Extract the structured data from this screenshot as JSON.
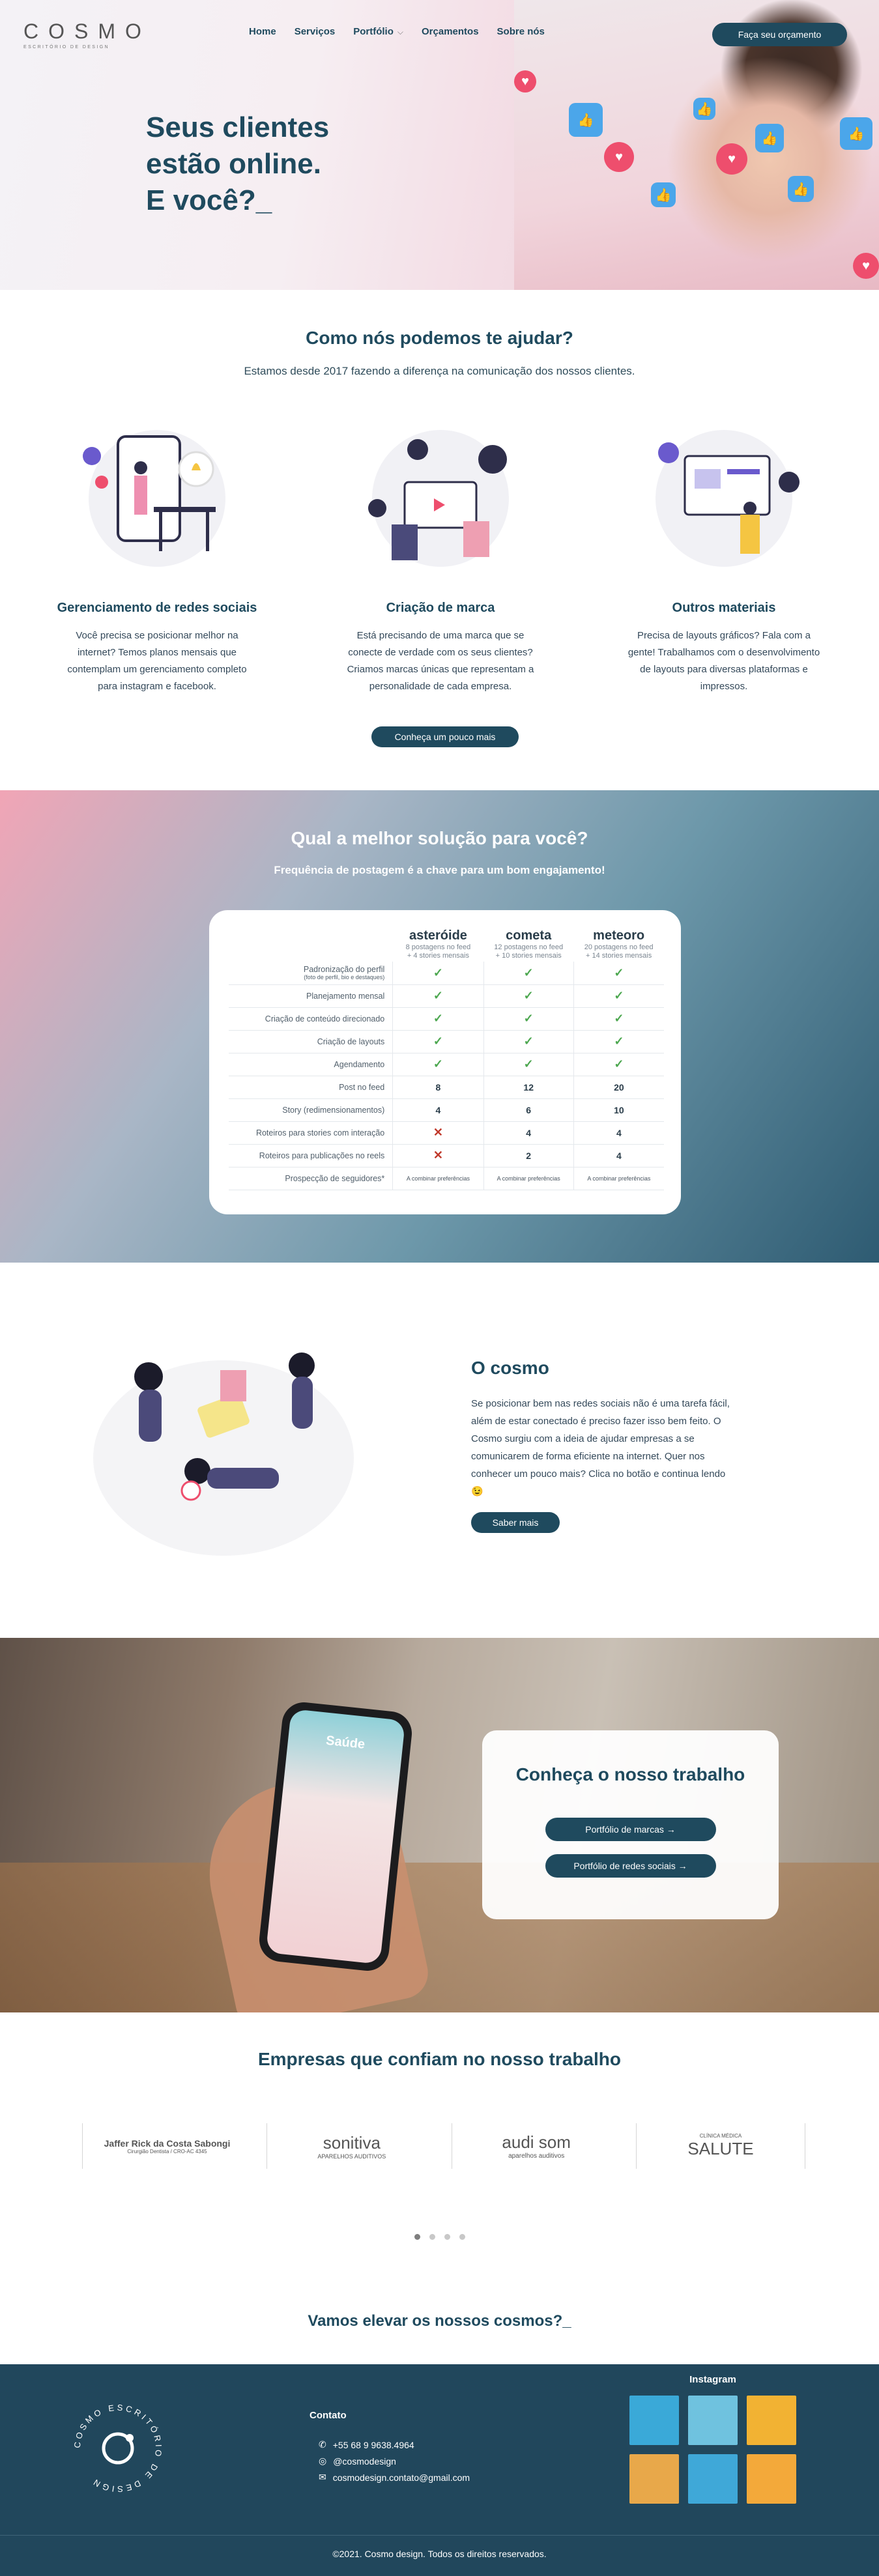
{
  "header": {
    "logo_word": "COSMO",
    "logo_sub": "ESCRITÓRIO DE DESIGN",
    "nav": [
      "Home",
      "Serviços",
      "Portfólio",
      "Orçamentos",
      "Sobre nós"
    ],
    "cta_label": "Faça seu orçamento"
  },
  "hero": {
    "title_line1": "Seus clientes",
    "title_line2": "estão online.",
    "title_line3": "E você?_"
  },
  "help": {
    "title": "Como nós podemos te ajudar?",
    "subtitle": "Estamos desde 2017 fazendo a diferença na comunicação dos nossos clientes.",
    "cards": [
      {
        "title": "Gerenciamento de redes sociais",
        "text": "Você precisa se posicionar melhor na internet? Temos planos mensais que contemplam um gerenciamento completo para instagram e facebook."
      },
      {
        "title": "Criação de marca",
        "text": "Está precisando de uma marca que se conecte de verdade com os seus clientes? Criamos marcas únicas que representam a personalidade de cada empresa."
      },
      {
        "title": "Outros materiais",
        "text": "Precisa de layouts gráficos? Fala com a gente! Trabalhamos com o desenvolvimento de layouts para diversas plataformas e impressos."
      }
    ],
    "button": "Conheça um pouco mais"
  },
  "pricing": {
    "title": "Qual a melhor solução para você?",
    "subtitle": "Frequência de postagem é a chave para um bom engajamento!",
    "plans": [
      {
        "name": "asteróide",
        "detail_1": "8 postagens no feed",
        "detail_2": "+ 4 stories mensais"
      },
      {
        "name": "cometa",
        "detail_1": "12 postagens no feed",
        "detail_2": "+ 10 stories mensais"
      },
      {
        "name": "meteoro",
        "detail_1": "20 postagens no feed",
        "detail_2": "+ 14 stories mensais"
      }
    ],
    "rows": [
      {
        "label": "Padronização do perfil",
        "sub": "(foto de perfil, bio e destaques)",
        "values": [
          "✓",
          "✓",
          "✓"
        ]
      },
      {
        "label": "Planejamento mensal",
        "sub": "",
        "values": [
          "✓",
          "✓",
          "✓"
        ]
      },
      {
        "label": "Criação de conteúdo direcionado",
        "sub": "",
        "values": [
          "✓",
          "✓",
          "✓"
        ]
      },
      {
        "label": "Criação de layouts",
        "sub": "",
        "values": [
          "✓",
          "✓",
          "✓"
        ]
      },
      {
        "label": "Agendamento",
        "sub": "",
        "values": [
          "✓",
          "✓",
          "✓"
        ]
      },
      {
        "label": "Post no feed",
        "sub": "",
        "values": [
          "8",
          "12",
          "20"
        ]
      },
      {
        "label": "Story (redimensionamentos)",
        "sub": "",
        "values": [
          "4",
          "6",
          "10"
        ]
      },
      {
        "label": "Roteiros para stories com interação",
        "sub": "",
        "values": [
          "✕",
          "4",
          "4"
        ]
      },
      {
        "label": "Roteiros para publicações no reels",
        "sub": "",
        "values": [
          "✕",
          "2",
          "4"
        ]
      },
      {
        "label": "Prospecção de seguidores*",
        "sub": "",
        "values": [
          "A combinar preferências",
          "A combinar preferências",
          "A combinar preferências"
        ]
      }
    ]
  },
  "about": {
    "title": "O cosmo",
    "text": "Se posicionar bem nas redes sociais não é uma tarefa fácil, além de estar conectado é preciso fazer isso bem feito. O Cosmo surgiu com a ideia de ajudar empresas a se comunicarem de forma eficiente na internet. Quer nos conhecer um pouco mais? Clica no botão e continua lendo 😉",
    "button": "Saber mais"
  },
  "work": {
    "title": "Conheça o nosso trabalho",
    "phone_label": "Saúde",
    "buttons": [
      "Portfólio de marcas →",
      "Portfólio de redes sociais →"
    ]
  },
  "clients": {
    "title": "Empresas que confiam no nosso trabalho",
    "logos": [
      "Jaffer Rick da Costa Sabongi",
      "sonitiva",
      "audi som",
      "SALUTE"
    ],
    "logo_subs": [
      "Cirurgião Dentista / CRO-AC 4345",
      "APARELHOS AUDITIVOS",
      "aparelhos auditivos",
      "CLÍNICA MÉDICA"
    ]
  },
  "elevate": {
    "title": "Vamos elevar os nossos cosmos?_"
  },
  "footer": {
    "seal_text": "COSMO ESCRITÓRIO DE DESIGN",
    "contact_title": "Contato",
    "phone": "+55 68 9 9638.4964",
    "instagram": "@cosmodesign",
    "email": "cosmodesign.contato@gmail.com",
    "instagram_title": "Instagram",
    "copyright": "©2021. Cosmo design. Todos os direitos reservados."
  },
  "colors": {
    "navy": "#1f4a5e",
    "pink": "#ee4e6d",
    "like_blue": "#4ba6ea",
    "check_green": "#4ca74f"
  }
}
